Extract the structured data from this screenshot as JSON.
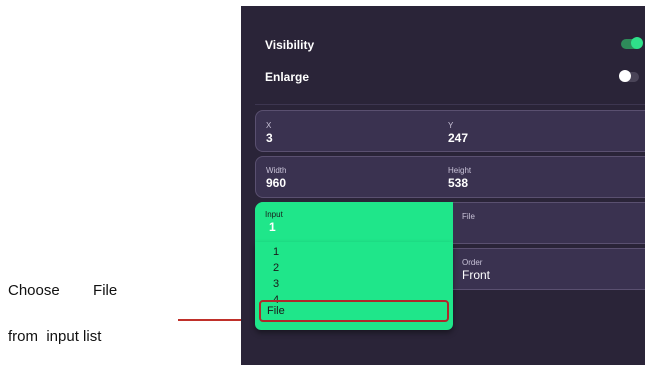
{
  "annotation": {
    "line1": "Choose        File",
    "line2": "from  input list"
  },
  "panel": {
    "visibility_label": "Visibility",
    "visibility_on": true,
    "enlarge_label": "Enlarge",
    "enlarge_on": false,
    "position": {
      "x_label": "X",
      "x_value": "3",
      "y_label": "Y",
      "y_value": "247"
    },
    "size": {
      "width_label": "Width",
      "width_value": "960",
      "height_label": "Height",
      "height_value": "538"
    },
    "input": {
      "label": "Input",
      "value": "1",
      "file_label": "File",
      "options": [
        "1",
        "2",
        "3",
        "4",
        "File"
      ],
      "highlighted_option": "File"
    },
    "order": {
      "label": "Order",
      "value": "Front"
    }
  },
  "colors": {
    "panel_bg": "#2a2438",
    "accent_green": "#1fe68a",
    "highlight_red": "#b0282a"
  }
}
